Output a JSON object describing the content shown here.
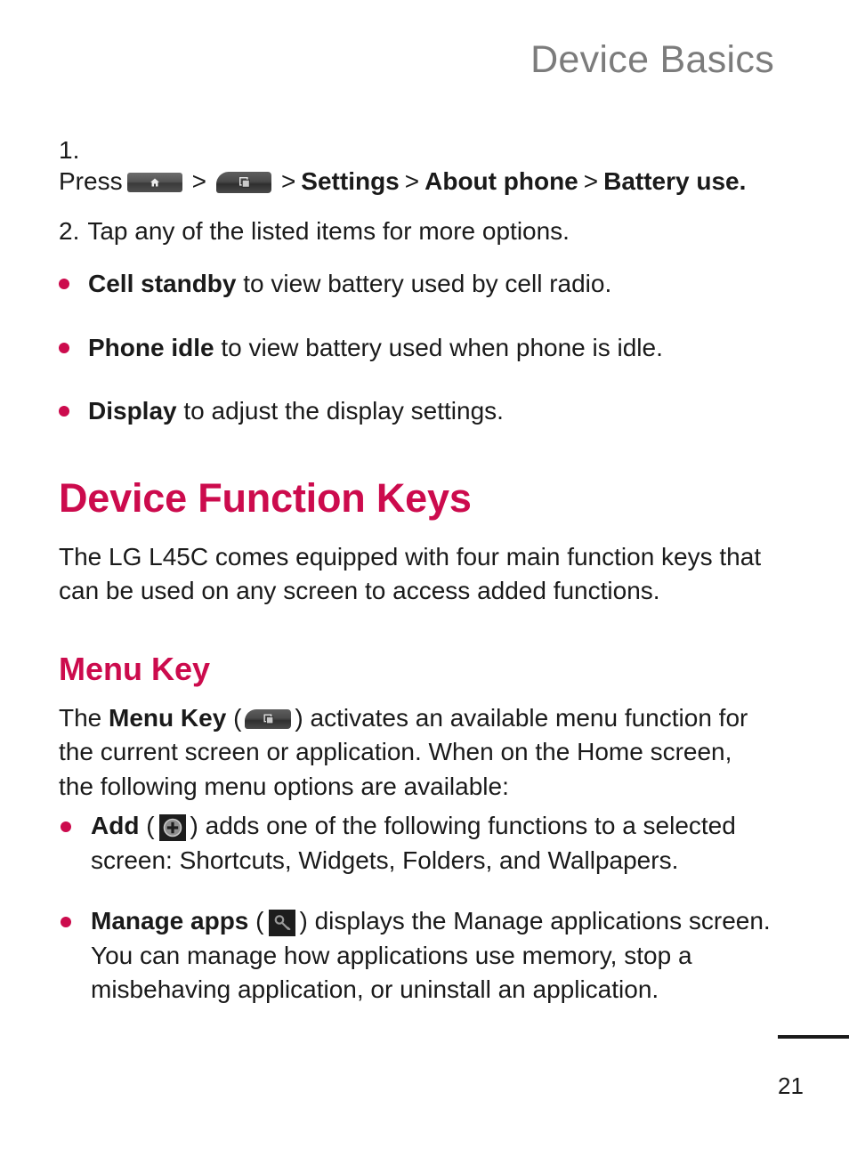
{
  "header": {
    "title": "Device Basics"
  },
  "steps": [
    {
      "number": "1.",
      "lead": "Press",
      "icons": [
        "home-key-icon",
        "menu-key-icon"
      ],
      "sep": ">",
      "parts": [
        "Settings",
        "About phone",
        "Battery use."
      ]
    },
    {
      "number": "2.",
      "text": "Tap any of the listed items for more options."
    }
  ],
  "sub_bullets": [
    {
      "term": "Cell standby",
      "rest": " to view battery used by cell radio."
    },
    {
      "term": "Phone idle",
      "rest": " to view battery used when phone is idle."
    },
    {
      "term": "Display",
      "rest": " to adjust the display settings."
    }
  ],
  "section": {
    "title": "Device Function Keys",
    "body": "The LG L45C comes equipped with four main function keys that can be used on any screen to access added functions."
  },
  "menu_key_section": {
    "title": "Menu Key",
    "body_before": "The ",
    "body_bold": "Menu Key",
    "body_paren_open": "(",
    "body_paren_close": ")",
    "body_after": " activates an available menu function for the current screen or application. When on the Home screen, the following menu options are available:",
    "icon": "menu-key-icon"
  },
  "main_bullets": [
    {
      "term": "Add",
      "paren_open": "(",
      "paren_close": ")",
      "icon": "add-plus-icon",
      "rest": " adds one of the following functions to a selected screen: Shortcuts, Widgets, Folders, and Wallpapers."
    },
    {
      "term": "Manage apps",
      "paren_open": "(",
      "paren_close": ")",
      "icon": "manage-apps-wrench-icon",
      "rest": " displays the Manage applications screen. You can manage how applications use memory, stop a misbehaving application, or uninstall an application."
    }
  ],
  "footer": {
    "page_number": "21"
  },
  "colors": {
    "accent": "#cc0b4d",
    "header_gray": "#7c7c7c",
    "body_black": "#1a1a1a"
  }
}
